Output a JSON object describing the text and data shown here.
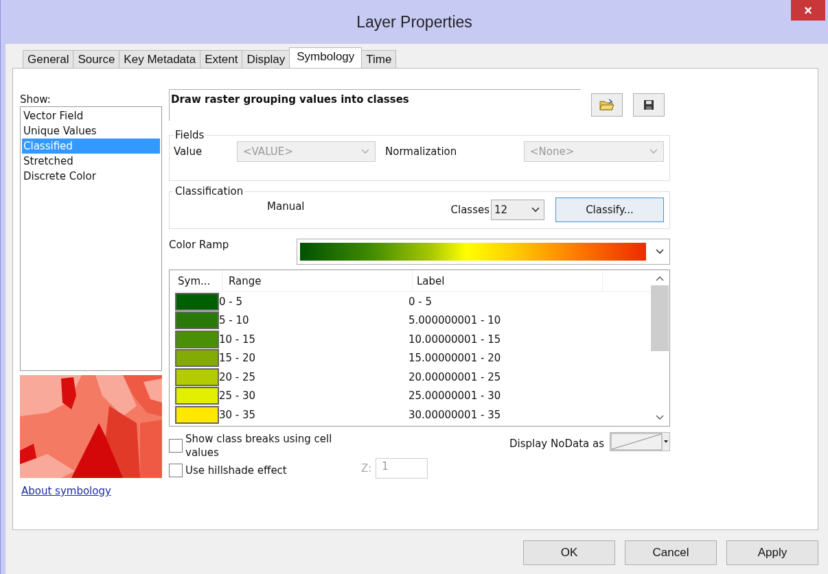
{
  "window": {
    "title": "Layer Properties",
    "close": "×"
  },
  "tabs": [
    {
      "label": "General",
      "selected": false
    },
    {
      "label": "Source",
      "selected": false
    },
    {
      "label": "Key Metadata",
      "selected": false
    },
    {
      "label": "Extent",
      "selected": false
    },
    {
      "label": "Display",
      "selected": false
    },
    {
      "label": "Symbology",
      "selected": true
    },
    {
      "label": "Time",
      "selected": false
    }
  ],
  "show": {
    "label": "Show:",
    "items": [
      {
        "label": "Vector Field",
        "selected": false
      },
      {
        "label": "Unique Values",
        "selected": false
      },
      {
        "label": "Classified",
        "selected": true
      },
      {
        "label": "Stretched",
        "selected": false
      },
      {
        "label": "Discrete Color",
        "selected": false
      }
    ]
  },
  "about_link": "About symbology",
  "description": "Draw raster grouping values into classes",
  "fields": {
    "title": "Fields",
    "value_label": "Value",
    "value": "<VALUE>",
    "value_disabled": true,
    "normalization_label": "Normalization",
    "normalization": "<None>",
    "normalization_disabled": true
  },
  "classification": {
    "title": "Classification",
    "method": "Manual",
    "classes_label": "Classes",
    "classes": "12",
    "classify_button": "Classify..."
  },
  "color_ramp": {
    "label": "Color Ramp"
  },
  "table": {
    "columns": [
      "Sym...",
      "Range",
      "Label"
    ],
    "rows": [
      {
        "color": "#005f00",
        "range": "0 - 5",
        "label": "0 - 5"
      },
      {
        "color": "#2a7a0a",
        "range": "5 - 10",
        "label": "5.000000001 - 10"
      },
      {
        "color": "#4a8f08",
        "range": "10 - 15",
        "label": "10.00000001 - 15"
      },
      {
        "color": "#84ab05",
        "range": "15 - 20",
        "label": "15.00000001 - 20"
      },
      {
        "color": "#b2cc00",
        "range": "20 - 25",
        "label": "20.00000001 - 25"
      },
      {
        "color": "#e2ef00",
        "range": "25 - 30",
        "label": "25.00000001 - 30"
      },
      {
        "color": "#ffe800",
        "range": "30 - 35",
        "label": "30.00000001 - 35"
      }
    ]
  },
  "options": [
    {
      "label": "Show class breaks using cell values",
      "checked": false
    },
    {
      "label": "Use hillshade effect",
      "checked": false
    }
  ],
  "z": {
    "label": "Z:",
    "value": "1",
    "disabled": true
  },
  "nodata": {
    "label": "Display NoData as"
  },
  "buttons": [
    "OK",
    "Cancel",
    "Apply"
  ]
}
